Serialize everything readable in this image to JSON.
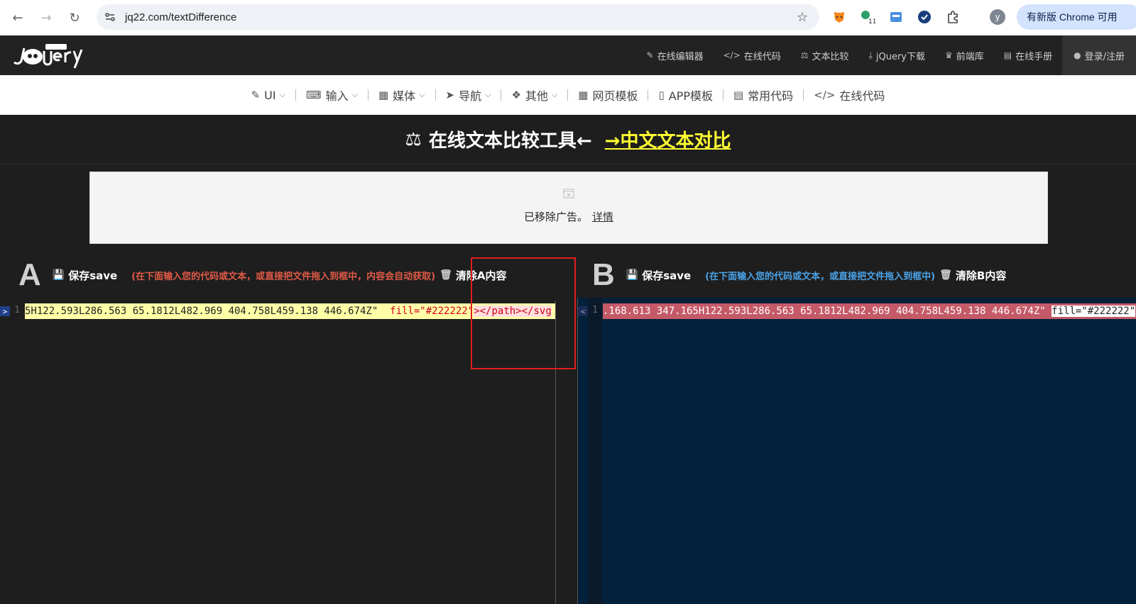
{
  "browser": {
    "url": "jq22.com/textDifference",
    "update_label": "有新版 Chrome 可用",
    "profile_initial": "y",
    "ext_badge": "11"
  },
  "header": {
    "nav": [
      {
        "icon": "edit-icon",
        "glyph": "✎",
        "label": "在线编辑器"
      },
      {
        "icon": "code-icon",
        "glyph": "</>",
        "label": "在线代码"
      },
      {
        "icon": "scale-icon",
        "glyph": "⚖",
        "label": "文本比较"
      },
      {
        "icon": "download-icon",
        "glyph": "⤓",
        "label": "jQuery下载"
      },
      {
        "icon": "library-icon",
        "glyph": "♛",
        "label": "前端库"
      },
      {
        "icon": "book-icon",
        "glyph": "▤",
        "label": "在线手册"
      },
      {
        "icon": "user-icon",
        "glyph": "●",
        "label": "登录/注册"
      }
    ]
  },
  "categories": [
    {
      "icon": "brush-icon",
      "glyph": "✎",
      "label": "UI",
      "dropdown": true
    },
    {
      "icon": "keyboard-icon",
      "glyph": "⌨",
      "label": "输入",
      "dropdown": true
    },
    {
      "icon": "film-icon",
      "glyph": "▦",
      "label": "媒体",
      "dropdown": true
    },
    {
      "icon": "send-icon",
      "glyph": "➤",
      "label": "导航",
      "dropdown": true
    },
    {
      "icon": "dropbox-icon",
      "glyph": "❖",
      "label": "其他",
      "dropdown": true
    },
    {
      "icon": "grid-icon",
      "glyph": "▦",
      "label": "网页模板",
      "dropdown": false
    },
    {
      "icon": "mobile-icon",
      "glyph": "▯",
      "label": "APP模板",
      "dropdown": false
    },
    {
      "icon": "file-code-icon",
      "glyph": "▤",
      "label": "常用代码",
      "dropdown": false
    },
    {
      "icon": "code-icon",
      "glyph": "</>",
      "label": "在线代码",
      "dropdown": false
    }
  ],
  "page": {
    "title": "在线文本比较工具←",
    "link": "→中文文本对比"
  },
  "ad": {
    "text": "已移除广告。",
    "detail": "详情"
  },
  "panel_a": {
    "letter": "A",
    "save": "保存save",
    "hint": "(在下面输入您的代码或文本，或直接把文件拖入到框中，内容会自动获取)",
    "clear": "清除A内容",
    "marker": ">",
    "line_no": "1",
    "code_part1": "5H122.593L286.563 65.1812L482.969 404.758L459.138 446.674Z\"  ",
    "code_part2": "fill=\"#222222\"",
    "code_part3": "></path></svg"
  },
  "panel_b": {
    "letter": "B",
    "save": "保存save",
    "hint": "(在下面输入您的代码或文本，或直接把文件拖入到框中)",
    "clear": "清除B内容",
    "marker": "<",
    "line_no": "1",
    "code_part1": ".168.613 347.165H122.593L286.563 65.1812L482.969 404.758L459.138 446.674Z\" ",
    "code_part2": "fill=\"#222222\""
  }
}
